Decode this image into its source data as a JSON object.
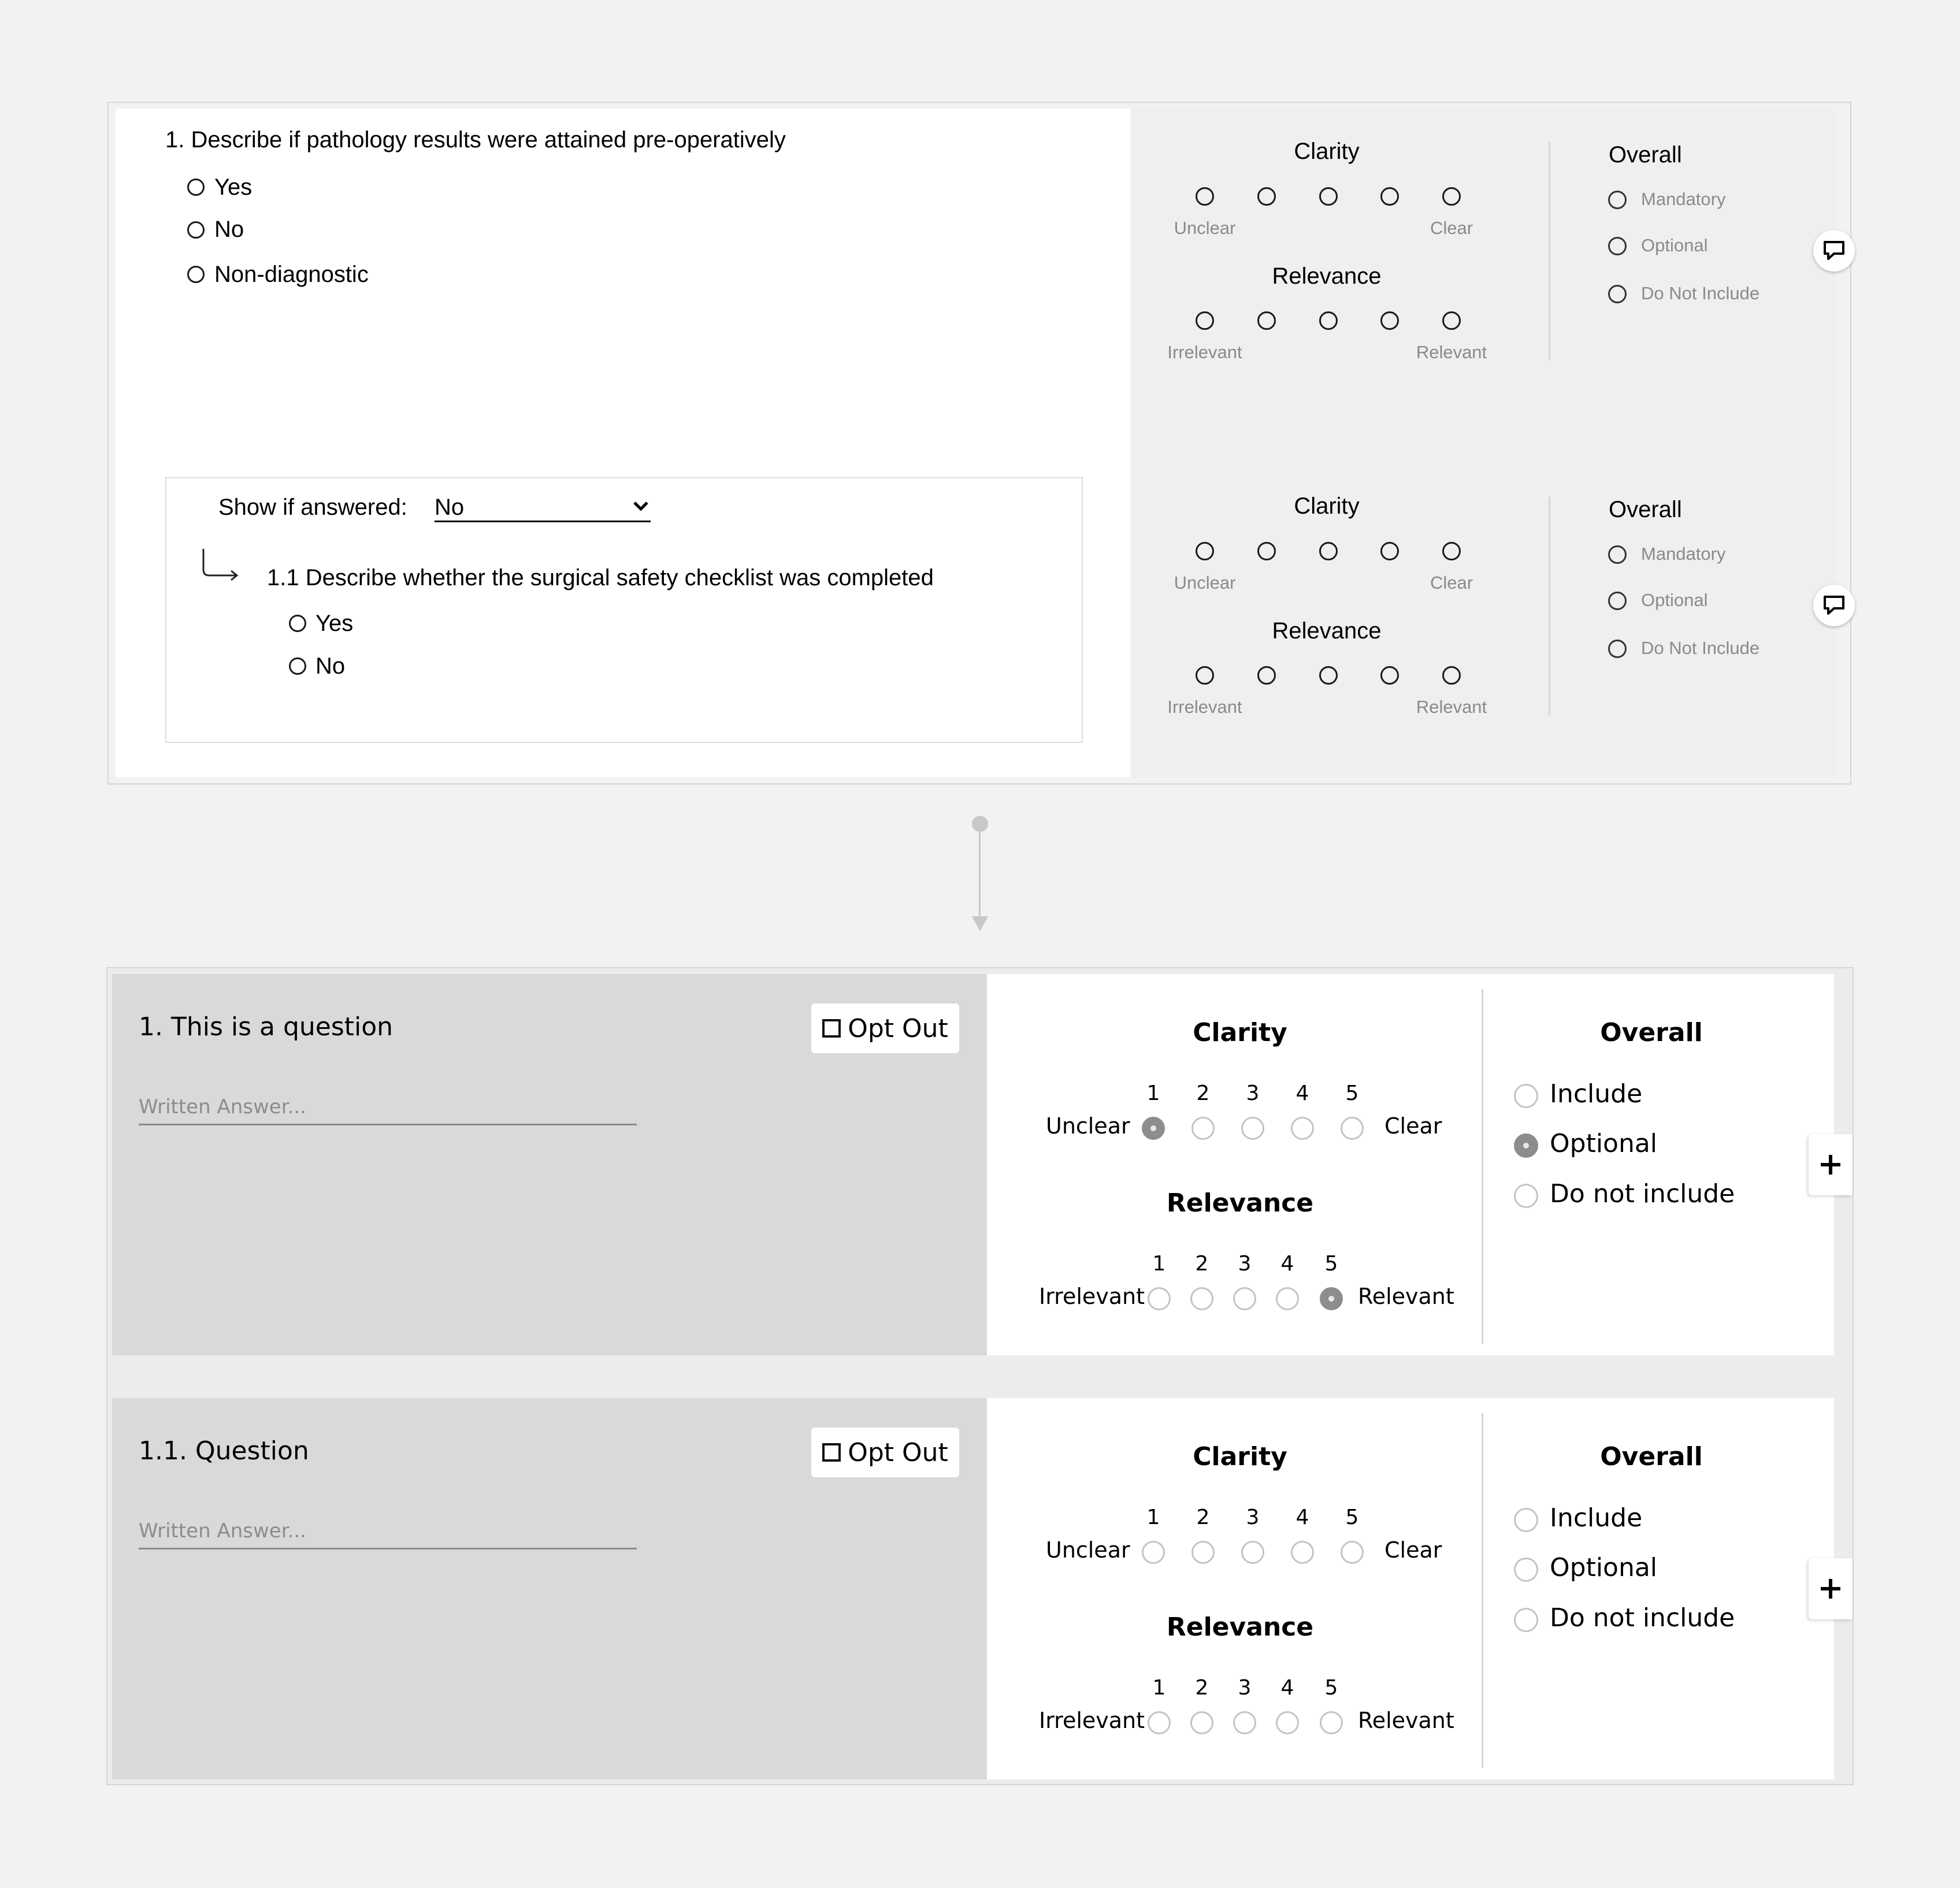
{
  "mockup": {
    "question1": {
      "text": "1. Describe if pathology results were attained pre-operatively",
      "options": [
        "Yes",
        "No",
        "Non-diagnostic"
      ]
    },
    "condition": {
      "label": "Show if answered:",
      "selected": "No"
    },
    "question1_1": {
      "text": "1.1 Describe whether the surgical safety checklist was completed",
      "options": [
        "Yes",
        "No"
      ]
    },
    "ratings": {
      "clarity": {
        "title": "Clarity",
        "low": "Unclear",
        "high": "Clear"
      },
      "relevance": {
        "title": "Relevance",
        "low": "Irrelevant",
        "high": "Relevant"
      }
    },
    "overall": {
      "title": "Overall",
      "options": [
        "Mandatory",
        "Optional",
        "Do Not Include"
      ]
    }
  },
  "design": {
    "cards": [
      {
        "question": "1. This is a question",
        "placeholder": "Written Answer...",
        "clarity_selected": 1,
        "relevance_selected": 5,
        "overall_selected": "Optional"
      },
      {
        "question": "1.1. Question",
        "placeholder": "Written Answer...",
        "clarity_selected": null,
        "relevance_selected": null,
        "overall_selected": null
      }
    ],
    "opt_out_label": "Opt Out",
    "clarity": {
      "title": "Clarity",
      "low": "Unclear",
      "high": "Clear"
    },
    "relevance": {
      "title": "Relevance",
      "low": "Irrelevant",
      "high": "Relevant"
    },
    "scale": [
      "1",
      "2",
      "3",
      "4",
      "5"
    ],
    "overall": {
      "title": "Overall",
      "options": [
        "Include",
        "Optional",
        "Do not include"
      ]
    }
  },
  "icons": {
    "comment": "comment-icon",
    "plus": "plus-icon",
    "dropdown": "chevron-down-icon",
    "branch": "branch-arrow-icon",
    "connector": "down-arrow-icon"
  },
  "colors": {
    "page_background": "#f2f2f2",
    "mockup_rating_panel": "#efefef",
    "design_question_panel": "#d9d9d9",
    "selected_radio": "#8d8d8d"
  }
}
